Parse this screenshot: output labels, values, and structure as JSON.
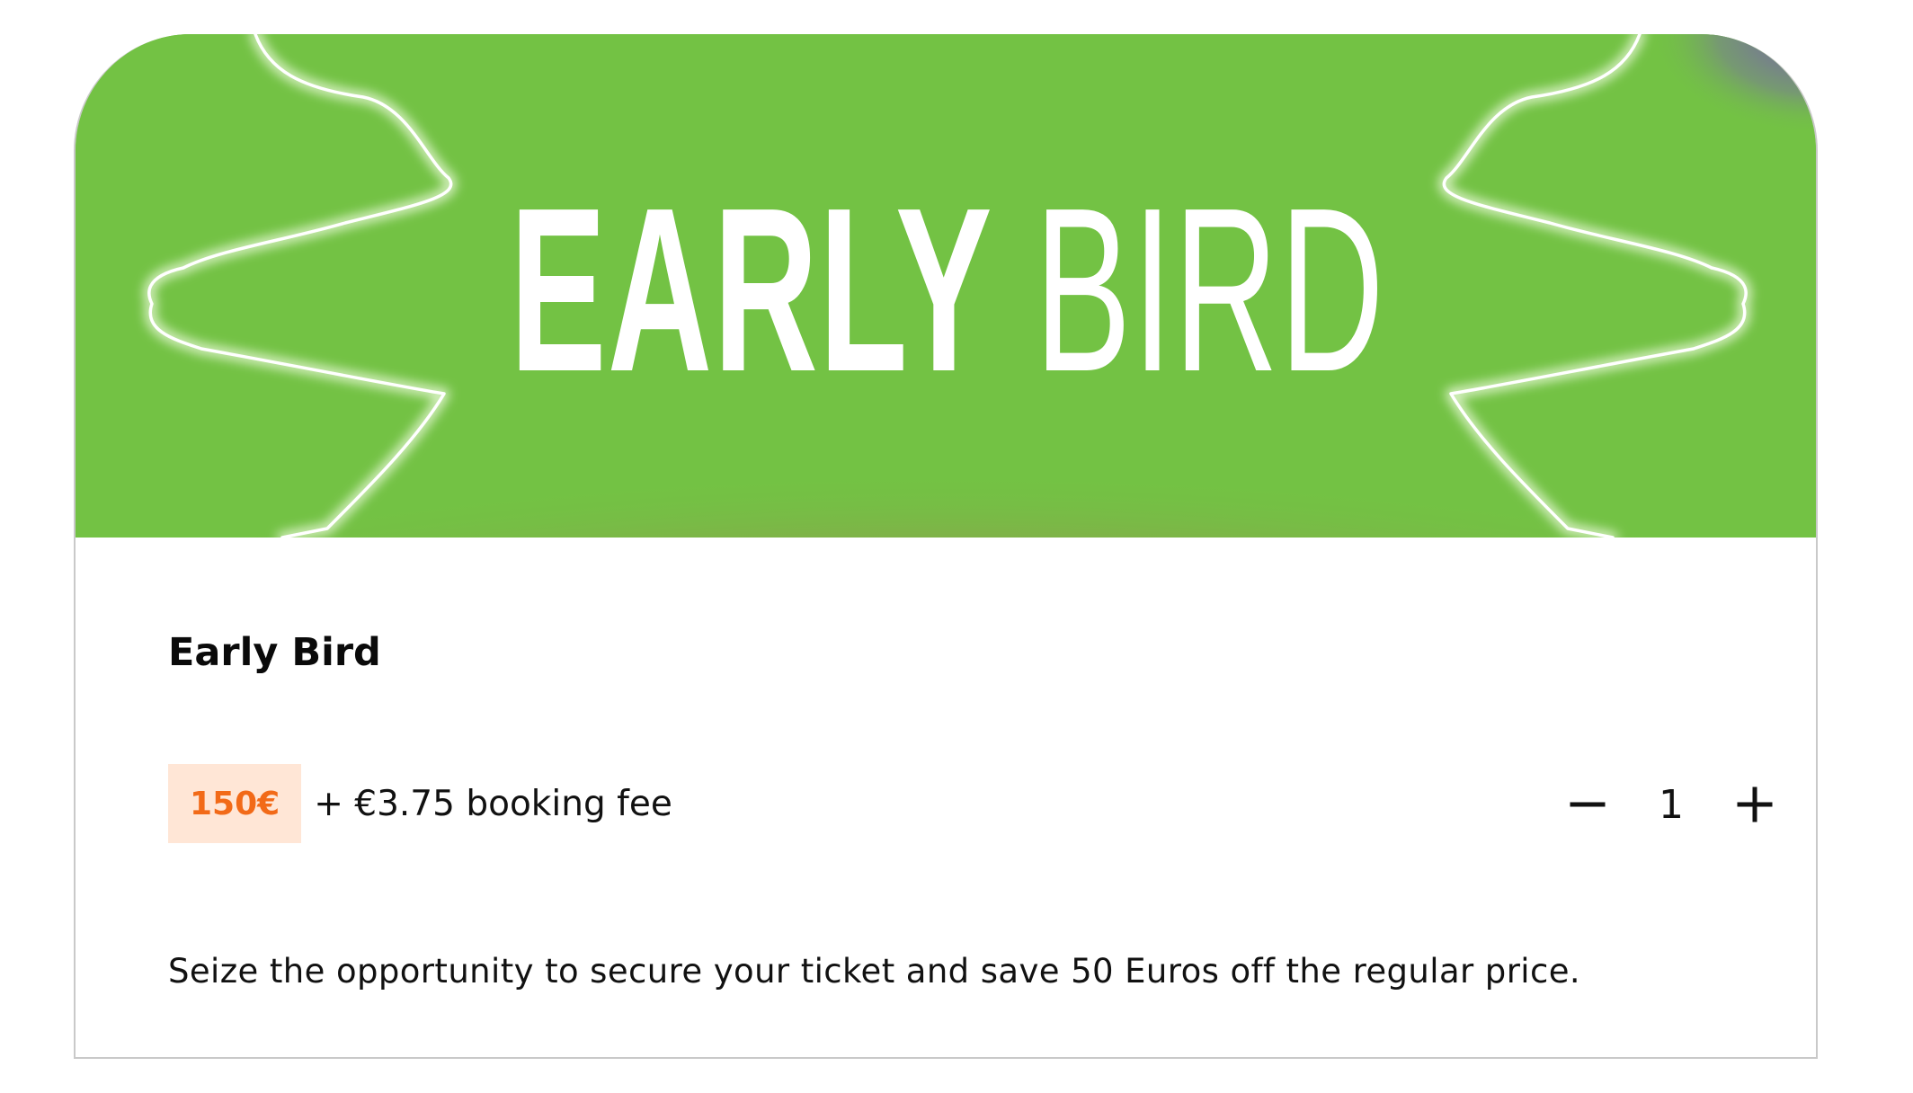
{
  "banner": {
    "title_bold": "EARLY",
    "title_light": "BIRD",
    "colors": {
      "green": "#73c244",
      "pink": "#e03c70",
      "purple": "#7a58b0",
      "neon": "#ffffff"
    }
  },
  "ticket": {
    "name": "Early Bird",
    "price": "150€",
    "booking_fee": "+ €3.75 booking fee",
    "description": "Seize the opportunity to secure your ticket and save 50 Euros off the regular price.",
    "colors": {
      "price_text": "#f26a18",
      "price_bg": "#ffe6d6"
    }
  },
  "quantity": {
    "value": "1",
    "decrease_icon": "minus-icon",
    "increase_icon": "plus-icon"
  }
}
